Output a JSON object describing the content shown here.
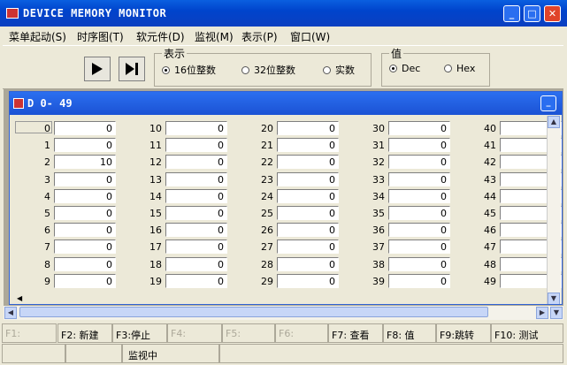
{
  "window": {
    "title": "DEVICE MEMORY MONITOR"
  },
  "menu": [
    {
      "label": "菜单起动(S)"
    },
    {
      "label": "时序图(T)"
    },
    {
      "label": "软元件(D)"
    },
    {
      "label": "监视(M)"
    },
    {
      "label": "表示(P)"
    },
    {
      "label": "窗口(W)"
    }
  ],
  "display_group": {
    "legend": "表示",
    "options": [
      "16位整数",
      "32位整数",
      "实数"
    ],
    "selected": "16位整数"
  },
  "value_group": {
    "legend": "值",
    "options": [
      "Dec",
      "Hex"
    ],
    "selected": "Dec"
  },
  "child_window": {
    "title": "D  0- 49"
  },
  "devices": [
    {
      "addr": "0",
      "value": "0"
    },
    {
      "addr": "1",
      "value": "0"
    },
    {
      "addr": "2",
      "value": "10"
    },
    {
      "addr": "3",
      "value": "0"
    },
    {
      "addr": "4",
      "value": "0"
    },
    {
      "addr": "5",
      "value": "0"
    },
    {
      "addr": "6",
      "value": "0"
    },
    {
      "addr": "7",
      "value": "0"
    },
    {
      "addr": "8",
      "value": "0"
    },
    {
      "addr": "9",
      "value": "0"
    },
    {
      "addr": "10",
      "value": "0"
    },
    {
      "addr": "11",
      "value": "0"
    },
    {
      "addr": "12",
      "value": "0"
    },
    {
      "addr": "13",
      "value": "0"
    },
    {
      "addr": "14",
      "value": "0"
    },
    {
      "addr": "15",
      "value": "0"
    },
    {
      "addr": "16",
      "value": "0"
    },
    {
      "addr": "17",
      "value": "0"
    },
    {
      "addr": "18",
      "value": "0"
    },
    {
      "addr": "19",
      "value": "0"
    },
    {
      "addr": "20",
      "value": "0"
    },
    {
      "addr": "21",
      "value": "0"
    },
    {
      "addr": "22",
      "value": "0"
    },
    {
      "addr": "23",
      "value": "0"
    },
    {
      "addr": "24",
      "value": "0"
    },
    {
      "addr": "25",
      "value": "0"
    },
    {
      "addr": "26",
      "value": "0"
    },
    {
      "addr": "27",
      "value": "0"
    },
    {
      "addr": "28",
      "value": "0"
    },
    {
      "addr": "29",
      "value": "0"
    },
    {
      "addr": "30",
      "value": "0"
    },
    {
      "addr": "31",
      "value": "0"
    },
    {
      "addr": "32",
      "value": "0"
    },
    {
      "addr": "33",
      "value": "0"
    },
    {
      "addr": "34",
      "value": "0"
    },
    {
      "addr": "35",
      "value": "0"
    },
    {
      "addr": "36",
      "value": "0"
    },
    {
      "addr": "37",
      "value": "0"
    },
    {
      "addr": "38",
      "value": "0"
    },
    {
      "addr": "39",
      "value": "0"
    },
    {
      "addr": "40",
      "value": ""
    },
    {
      "addr": "41",
      "value": ""
    },
    {
      "addr": "42",
      "value": ""
    },
    {
      "addr": "43",
      "value": ""
    },
    {
      "addr": "44",
      "value": ""
    },
    {
      "addr": "45",
      "value": ""
    },
    {
      "addr": "46",
      "value": ""
    },
    {
      "addr": "47",
      "value": ""
    },
    {
      "addr": "48",
      "value": ""
    },
    {
      "addr": "49",
      "value": ""
    }
  ],
  "function_keys": [
    {
      "label": "F1:",
      "enabled": false
    },
    {
      "label": "F2: 新建",
      "enabled": true
    },
    {
      "label": "F3:停止",
      "enabled": true
    },
    {
      "label": "F4:",
      "enabled": false
    },
    {
      "label": "F5:",
      "enabled": false
    },
    {
      "label": "F6:",
      "enabled": false
    },
    {
      "label": "F7: 查看",
      "enabled": true
    },
    {
      "label": "F8: 值",
      "enabled": true
    },
    {
      "label": "F9:跳转",
      "enabled": true
    },
    {
      "label": "F10: 测试",
      "enabled": true
    }
  ],
  "status": {
    "text": "监视中"
  }
}
